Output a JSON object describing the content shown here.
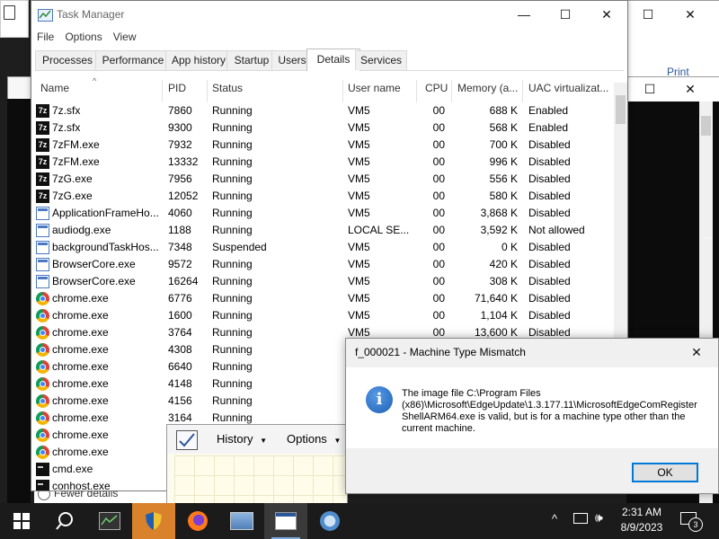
{
  "background": {
    "right_window_text": "Print"
  },
  "task_manager": {
    "title": "Task Manager",
    "menu": [
      "File",
      "Options",
      "View"
    ],
    "tabs": [
      "Processes",
      "Performance",
      "App history",
      "Startup",
      "Users",
      "Details",
      "Services"
    ],
    "active_tab": "Details",
    "columns": [
      "Name",
      "PID",
      "Status",
      "User name",
      "CPU",
      "Memory (a...",
      "UAC virtualizat..."
    ],
    "rows": [
      {
        "icon": "7zip-icon",
        "name": "7z.sfx",
        "pid": "7860",
        "status": "Running",
        "user": "VM5",
        "cpu": "00",
        "mem": "688 K",
        "uac": "Enabled"
      },
      {
        "icon": "7zip-icon",
        "name": "7z.sfx",
        "pid": "9300",
        "status": "Running",
        "user": "VM5",
        "cpu": "00",
        "mem": "568 K",
        "uac": "Enabled"
      },
      {
        "icon": "7zip-icon",
        "name": "7zFM.exe",
        "pid": "7932",
        "status": "Running",
        "user": "VM5",
        "cpu": "00",
        "mem": "700 K",
        "uac": "Disabled"
      },
      {
        "icon": "7zip-icon",
        "name": "7zFM.exe",
        "pid": "13332",
        "status": "Running",
        "user": "VM5",
        "cpu": "00",
        "mem": "996 K",
        "uac": "Disabled"
      },
      {
        "icon": "7zip-icon",
        "name": "7zG.exe",
        "pid": "7956",
        "status": "Running",
        "user": "VM5",
        "cpu": "00",
        "mem": "556 K",
        "uac": "Disabled"
      },
      {
        "icon": "7zip-icon",
        "name": "7zG.exe",
        "pid": "12052",
        "status": "Running",
        "user": "VM5",
        "cpu": "00",
        "mem": "580 K",
        "uac": "Disabled"
      },
      {
        "icon": "app-icon",
        "name": "ApplicationFrameHo...",
        "pid": "4060",
        "status": "Running",
        "user": "VM5",
        "cpu": "00",
        "mem": "3,868 K",
        "uac": "Disabled"
      },
      {
        "icon": "app-icon",
        "name": "audiodg.exe",
        "pid": "1188",
        "status": "Running",
        "user": "LOCAL SE...",
        "cpu": "00",
        "mem": "3,592 K",
        "uac": "Not allowed"
      },
      {
        "icon": "app-icon",
        "name": "backgroundTaskHos...",
        "pid": "7348",
        "status": "Suspended",
        "user": "VM5",
        "cpu": "00",
        "mem": "0 K",
        "uac": "Disabled"
      },
      {
        "icon": "app-icon",
        "name": "BrowserCore.exe",
        "pid": "9572",
        "status": "Running",
        "user": "VM5",
        "cpu": "00",
        "mem": "420 K",
        "uac": "Disabled"
      },
      {
        "icon": "app-icon",
        "name": "BrowserCore.exe",
        "pid": "16264",
        "status": "Running",
        "user": "VM5",
        "cpu": "00",
        "mem": "308 K",
        "uac": "Disabled"
      },
      {
        "icon": "chrome-icon",
        "name": "chrome.exe",
        "pid": "6776",
        "status": "Running",
        "user": "VM5",
        "cpu": "00",
        "mem": "71,640 K",
        "uac": "Disabled"
      },
      {
        "icon": "chrome-icon",
        "name": "chrome.exe",
        "pid": "1600",
        "status": "Running",
        "user": "VM5",
        "cpu": "00",
        "mem": "1,104 K",
        "uac": "Disabled"
      },
      {
        "icon": "chrome-icon",
        "name": "chrome.exe",
        "pid": "3764",
        "status": "Running",
        "user": "VM5",
        "cpu": "00",
        "mem": "13,600 K",
        "uac": "Disabled"
      },
      {
        "icon": "chrome-icon",
        "name": "chrome.exe",
        "pid": "4308",
        "status": "Running",
        "user": "",
        "cpu": "",
        "mem": "",
        "uac": ""
      },
      {
        "icon": "chrome-icon",
        "name": "chrome.exe",
        "pid": "6640",
        "status": "Running",
        "user": "",
        "cpu": "",
        "mem": "",
        "uac": ""
      },
      {
        "icon": "chrome-icon",
        "name": "chrome.exe",
        "pid": "4148",
        "status": "Running",
        "user": "",
        "cpu": "",
        "mem": "",
        "uac": ""
      },
      {
        "icon": "chrome-icon",
        "name": "chrome.exe",
        "pid": "4156",
        "status": "Running",
        "user": "",
        "cpu": "",
        "mem": "",
        "uac": ""
      },
      {
        "icon": "chrome-icon",
        "name": "chrome.exe",
        "pid": "3164",
        "status": "Running",
        "user": "",
        "cpu": "",
        "mem": "",
        "uac": ""
      },
      {
        "icon": "chrome-icon",
        "name": "chrome.exe",
        "pid": "",
        "status": "",
        "user": "",
        "cpu": "",
        "mem": "",
        "uac": ""
      },
      {
        "icon": "chrome-icon",
        "name": "chrome.exe",
        "pid": "",
        "status": "",
        "user": "",
        "cpu": "",
        "mem": "",
        "uac": ""
      },
      {
        "icon": "cmd-icon",
        "name": "cmd.exe",
        "pid": "",
        "status": "",
        "user": "",
        "cpu": "",
        "mem": "",
        "uac": ""
      },
      {
        "icon": "cmd-icon",
        "name": "conhost.exe",
        "pid": "",
        "status": "",
        "user": "",
        "cpu": "",
        "mem": "",
        "uac": ""
      }
    ],
    "footer": "Fewer details"
  },
  "history_window": {
    "menu_history": "History",
    "menu_options": "Options"
  },
  "dialog": {
    "title": "f_000021 - Machine Type Mismatch",
    "message": "The image file C:\\Program Files (x86)\\Microsoft\\EdgeUpdate\\1.3.177.11\\MicrosoftEdgeComRegisterShellARM64.exe is valid, but is for a machine type other than the current machine.",
    "ok_label": "OK"
  },
  "taskbar": {
    "time": "2:31 AM",
    "date": "8/9/2023",
    "notification_count": "3"
  },
  "colors": {
    "accent": "#0078d7",
    "taskbar": "#1b1b1b"
  }
}
